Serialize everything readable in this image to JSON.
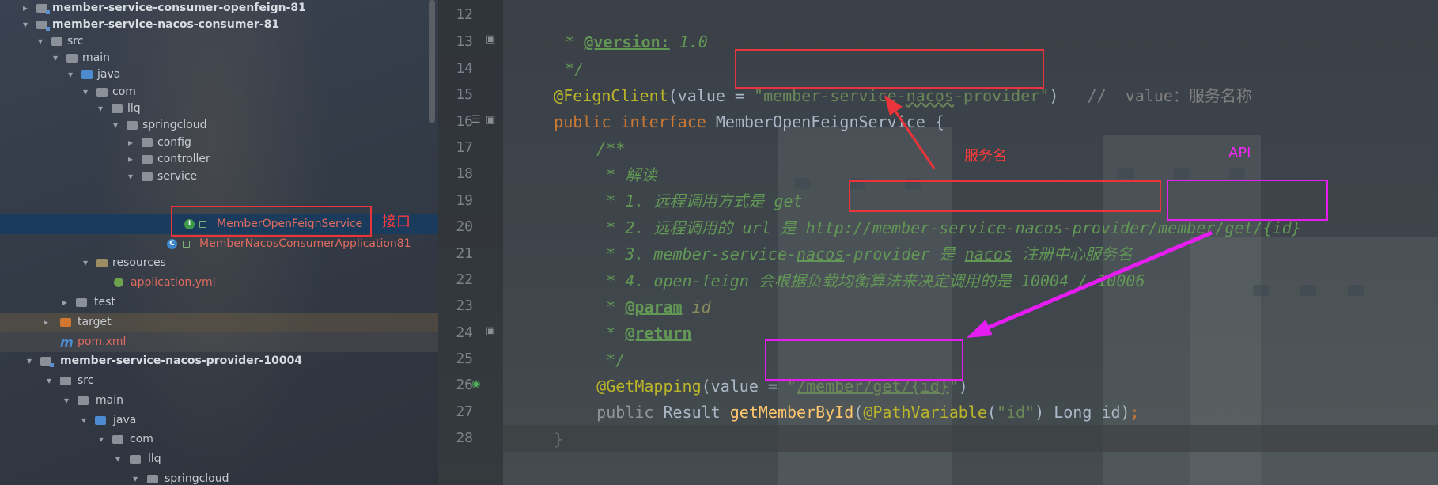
{
  "project_tree": {
    "items": [
      {
        "label": "member-service-consumer-openfeign-81",
        "icon": "module-folder-icon",
        "expanded": false
      },
      {
        "label": "member-service-nacos-consumer-81",
        "icon": "module-folder-icon",
        "expanded": true
      },
      {
        "label": "src",
        "icon": "folder-icon",
        "expanded": true
      },
      {
        "label": "main",
        "icon": "folder-icon",
        "expanded": true
      },
      {
        "label": "java",
        "icon": "source-folder-icon",
        "expanded": true
      },
      {
        "label": "com",
        "icon": "package-icon",
        "expanded": true
      },
      {
        "label": "llq",
        "icon": "package-icon",
        "expanded": true
      },
      {
        "label": "springcloud",
        "icon": "package-icon",
        "expanded": true
      },
      {
        "label": "config",
        "icon": "package-icon",
        "expanded": false
      },
      {
        "label": "controller",
        "icon": "package-icon",
        "expanded": false
      },
      {
        "label": "service",
        "icon": "package-icon",
        "expanded": true
      },
      {
        "label": "MemberOpenFeignService",
        "icon": "interface-icon",
        "selected": true
      },
      {
        "label": "MemberNacosConsumerApplication81",
        "icon": "spring-app-icon"
      },
      {
        "label": "resources",
        "icon": "resources-folder-icon",
        "expanded": true
      },
      {
        "label": "application.yml",
        "icon": "yaml-file-icon"
      },
      {
        "label": "test",
        "icon": "folder-icon",
        "expanded": false
      },
      {
        "label": "target",
        "icon": "target-folder-icon",
        "expanded": false
      },
      {
        "label": "pom.xml",
        "icon": "maven-icon"
      },
      {
        "label": "member-service-nacos-provider-10004",
        "icon": "module-folder-icon",
        "expanded": true
      },
      {
        "label": "src",
        "icon": "folder-icon",
        "expanded": true
      },
      {
        "label": "main",
        "icon": "folder-icon",
        "expanded": true
      },
      {
        "label": "java",
        "icon": "source-folder-icon",
        "expanded": true
      },
      {
        "label": "com",
        "icon": "package-icon",
        "expanded": true
      },
      {
        "label": "llq",
        "icon": "package-icon",
        "expanded": true
      },
      {
        "label": "springcloud",
        "icon": "package-icon",
        "expanded": true
      }
    ]
  },
  "editor": {
    "line_numbers": [
      "12",
      "13",
      "14",
      "15",
      "16",
      "17",
      "18",
      "19",
      "20",
      "21",
      "22",
      "23",
      "24",
      "25",
      "26",
      "27",
      "28"
    ],
    "code": {
      "l12_star": " * ",
      "l12_tag": "@version:",
      "l12_val": " 1.0",
      "l13": " */",
      "l14_ann": "@FeignClient",
      "l14_a": "(value = ",
      "l14_q1": "\"",
      "l14_s1": "member-service-",
      "l14_s2": "nacos",
      "l14_s3": "-provider",
      "l14_q2": "\"",
      "l14_b": ")",
      "l14_cmt": "   //  value：服务名称",
      "l15_kw1": "public",
      "l15_kw2": "interface",
      "l15_name": " MemberOpenFeignService {",
      "l16": "/**",
      "l17": " * 解读",
      "l18": " * 1. 远程调用方式是 get",
      "l19": " * 2. 远程调用的 url 是 http://member-service-nacos-provider/member/get/{id}",
      "l20_a": " * 3. member-service-",
      "l20_b": "nacos",
      "l20_c": "-provider 是 ",
      "l20_d": "nacos",
      "l20_e": " 注册中心服务名",
      "l21": " * 4. open-feign 会根据负载均衡算法来决定调用的是 10004 / 10006",
      "l22_star": " * ",
      "l22_tag": "@param",
      "l22_p": " id",
      "l23_star": " * ",
      "l23_tag": "@return",
      "l24": " */",
      "l25_ann": "@GetMapping",
      "l25_a": "(value = ",
      "l25_q1": "\"",
      "l25_s": "/member/get/{id}",
      "l25_q2": "\"",
      "l25_b": ")",
      "l26_kw": "public",
      "l26_type": " Result ",
      "l26_fn": "getMemberById",
      "l26_a": "(",
      "l26_ann": "@PathVariable",
      "l26_b": "(",
      "l26_q": "\"id\"",
      "l26_c": ") Long id)",
      "l26_semi": ";",
      "l27": "}",
      "l28": ""
    }
  },
  "annotations": {
    "tree_note": "接口",
    "service_name_note": "服务名",
    "api_note": "API",
    "red_color": "#e8343a",
    "pink_color": "#e51df0"
  },
  "colors": {
    "keyword": "#cc7832",
    "annotation": "#bbb529",
    "string": "#6a8759",
    "doc_comment": "#629755",
    "method": "#ffc66d",
    "selection": "#1b3b5c"
  }
}
